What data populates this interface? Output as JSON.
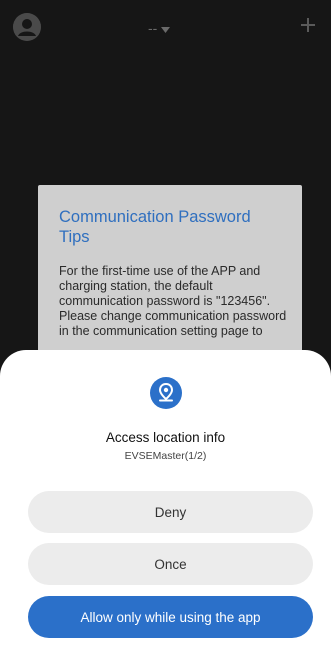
{
  "header": {
    "title_select": "--",
    "dropdown_icon": "caret-down-icon",
    "add_icon": "plus-icon",
    "avatar_icon": "user-avatar-icon"
  },
  "tips": {
    "title": "Communication Password Tips",
    "body": "For the first-time use of the APP and charging station, the default communication password is \"123456\". Please change communication password in the communication setting page to"
  },
  "permission_dialog": {
    "icon": "location-pin-icon",
    "title": "Access location info",
    "subtitle": "EVSEMaster(1/2)",
    "buttons": {
      "deny": "Deny",
      "once": "Once",
      "allow": "Allow only while using the app"
    }
  },
  "colors": {
    "accent": "#2b70c9",
    "background": "#161616",
    "card": "#cfcfcf",
    "button_grey": "#ececec"
  }
}
